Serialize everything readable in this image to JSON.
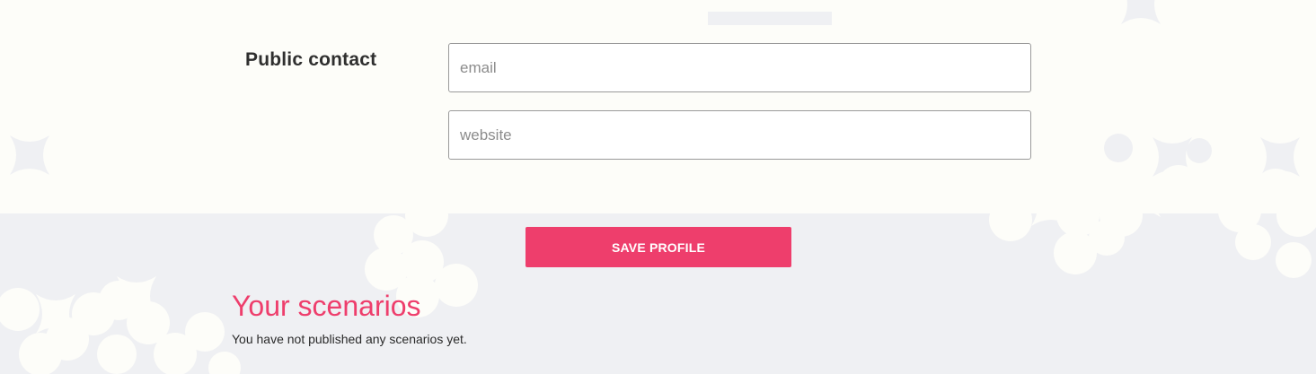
{
  "profile": {
    "public_contact_label": "Public contact",
    "email_placeholder": "email",
    "email_value": "",
    "website_placeholder": "website",
    "website_value": "",
    "save_label": "SAVE PROFILE"
  },
  "scenarios": {
    "title": "Your scenarios",
    "empty_message": "You have not published any scenarios yet."
  },
  "colors": {
    "accent": "#ee3e6c",
    "page_background": "#fdfdf9",
    "pattern_background": "#eff0f3"
  }
}
